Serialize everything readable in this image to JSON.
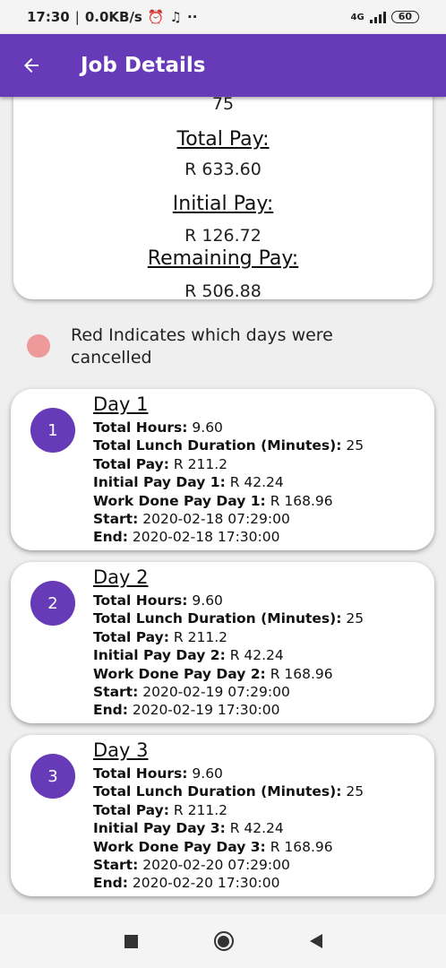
{
  "status_bar": {
    "time": "17:30",
    "speed": "0.0KB/s",
    "dots": "··",
    "network": "4G",
    "battery": "60"
  },
  "app_bar": {
    "title": "Job Details"
  },
  "summary": {
    "top_value": "75",
    "total_pay_label": "Total Pay:",
    "total_pay_value": "R 633.60",
    "initial_pay_label": "Initial Pay:",
    "initial_pay_value": "R 126.72",
    "remaining_pay_label": "Remaining Pay:",
    "remaining_pay_value": "R 506.88"
  },
  "legend": {
    "color": "#ef9a9a",
    "text": "Red Indicates which days were cancelled"
  },
  "days": [
    {
      "number": "1",
      "title": "Day 1",
      "total_hours_label": "Total Hours:",
      "total_hours": "9.60",
      "lunch_label": "Total Lunch Duration (Minutes):",
      "lunch": "25",
      "total_pay_label": "Total Pay:",
      "total_pay": "R 211.2",
      "initial_pay_label": "Initial Pay Day 1:",
      "initial_pay": "R 42.24",
      "work_pay_label": "Work Done Pay Day 1:",
      "work_pay": "R 168.96",
      "start_label": "Start:",
      "start": "2020-02-18 07:29:00",
      "end_label": "End:",
      "end": "2020-02-18 17:30:00"
    },
    {
      "number": "2",
      "title": "Day 2",
      "total_hours_label": "Total Hours:",
      "total_hours": "9.60",
      "lunch_label": "Total Lunch Duration (Minutes):",
      "lunch": "25",
      "total_pay_label": "Total Pay:",
      "total_pay": "R 211.2",
      "initial_pay_label": "Initial Pay Day 2:",
      "initial_pay": "R 42.24",
      "work_pay_label": "Work Done Pay Day 2:",
      "work_pay": "R 168.96",
      "start_label": "Start:",
      "start": "2020-02-19 07:29:00",
      "end_label": "End:",
      "end": "2020-02-19 17:30:00"
    },
    {
      "number": "3",
      "title": "Day 3",
      "total_hours_label": "Total Hours:",
      "total_hours": "9.60",
      "lunch_label": "Total Lunch Duration (Minutes):",
      "lunch": "25",
      "total_pay_label": "Total Pay:",
      "total_pay": "R 211.2",
      "initial_pay_label": "Initial Pay Day 3:",
      "initial_pay": "R 42.24",
      "work_pay_label": "Work Done Pay Day 3:",
      "work_pay": "R 168.96",
      "start_label": "Start:",
      "start": "2020-02-20 07:29:00",
      "end_label": "End:",
      "end": "2020-02-20 17:30:00"
    }
  ],
  "colors": {
    "primary": "#673ab7",
    "background": "#efefef"
  }
}
